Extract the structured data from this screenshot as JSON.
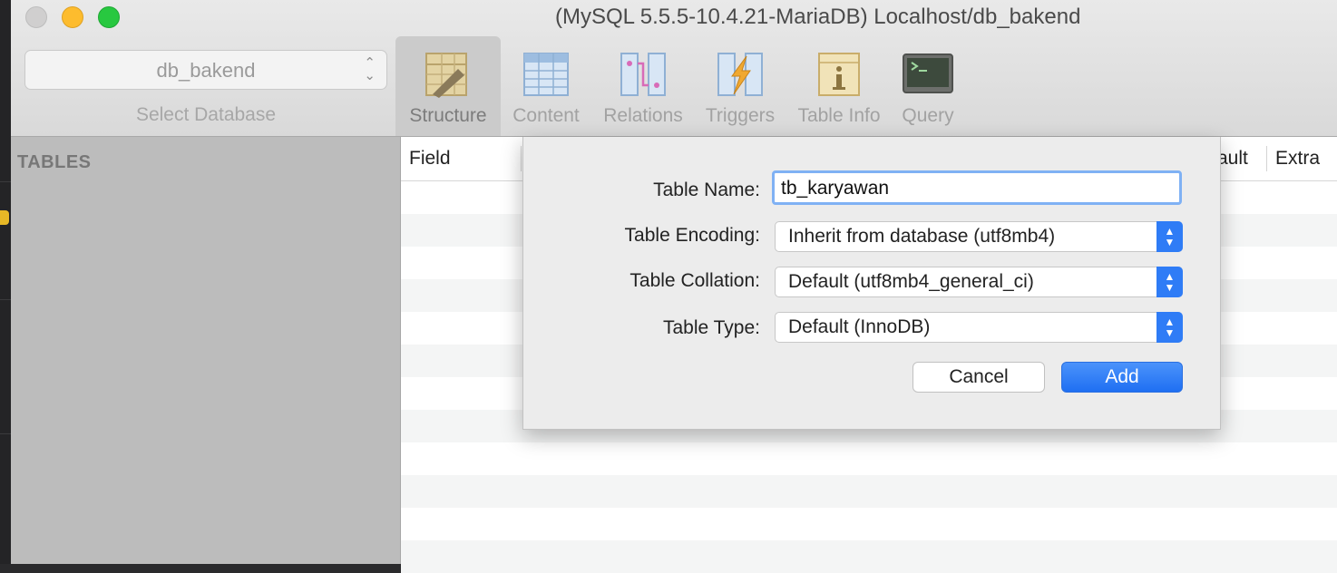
{
  "window": {
    "title": "(MySQL 5.5.5-10.4.21-MariaDB) Localhost/db_bakend"
  },
  "database": {
    "selected": "db_bakend",
    "caption": "Select Database"
  },
  "toolbar": [
    {
      "label": "Structure",
      "icon": "structure-icon",
      "active": true
    },
    {
      "label": "Content",
      "icon": "content-icon",
      "active": false
    },
    {
      "label": "Relations",
      "icon": "relations-icon",
      "active": false
    },
    {
      "label": "Triggers",
      "icon": "triggers-icon",
      "active": false
    },
    {
      "label": "Table Info",
      "icon": "table-info-icon",
      "active": false
    },
    {
      "label": "Query",
      "icon": "query-icon",
      "active": false
    }
  ],
  "sidebar": {
    "header": "TABLES"
  },
  "table": {
    "columns": [
      "Field",
      "ault",
      "Extra"
    ]
  },
  "dialog": {
    "name_label": "Table Name:",
    "name_value": "tb_karyawan",
    "encoding_label": "Table Encoding:",
    "encoding_value": "Inherit from database (utf8mb4)",
    "collation_label": "Table Collation:",
    "collation_value": "Default (utf8mb4_general_ci)",
    "type_label": "Table Type:",
    "type_value": "Default (InnoDB)",
    "cancel_label": "Cancel",
    "add_label": "Add"
  },
  "colors": {
    "accent": "#2f7cf6",
    "sidebar": "#bcbcbc",
    "focus_ring": "#7fb1f4"
  }
}
